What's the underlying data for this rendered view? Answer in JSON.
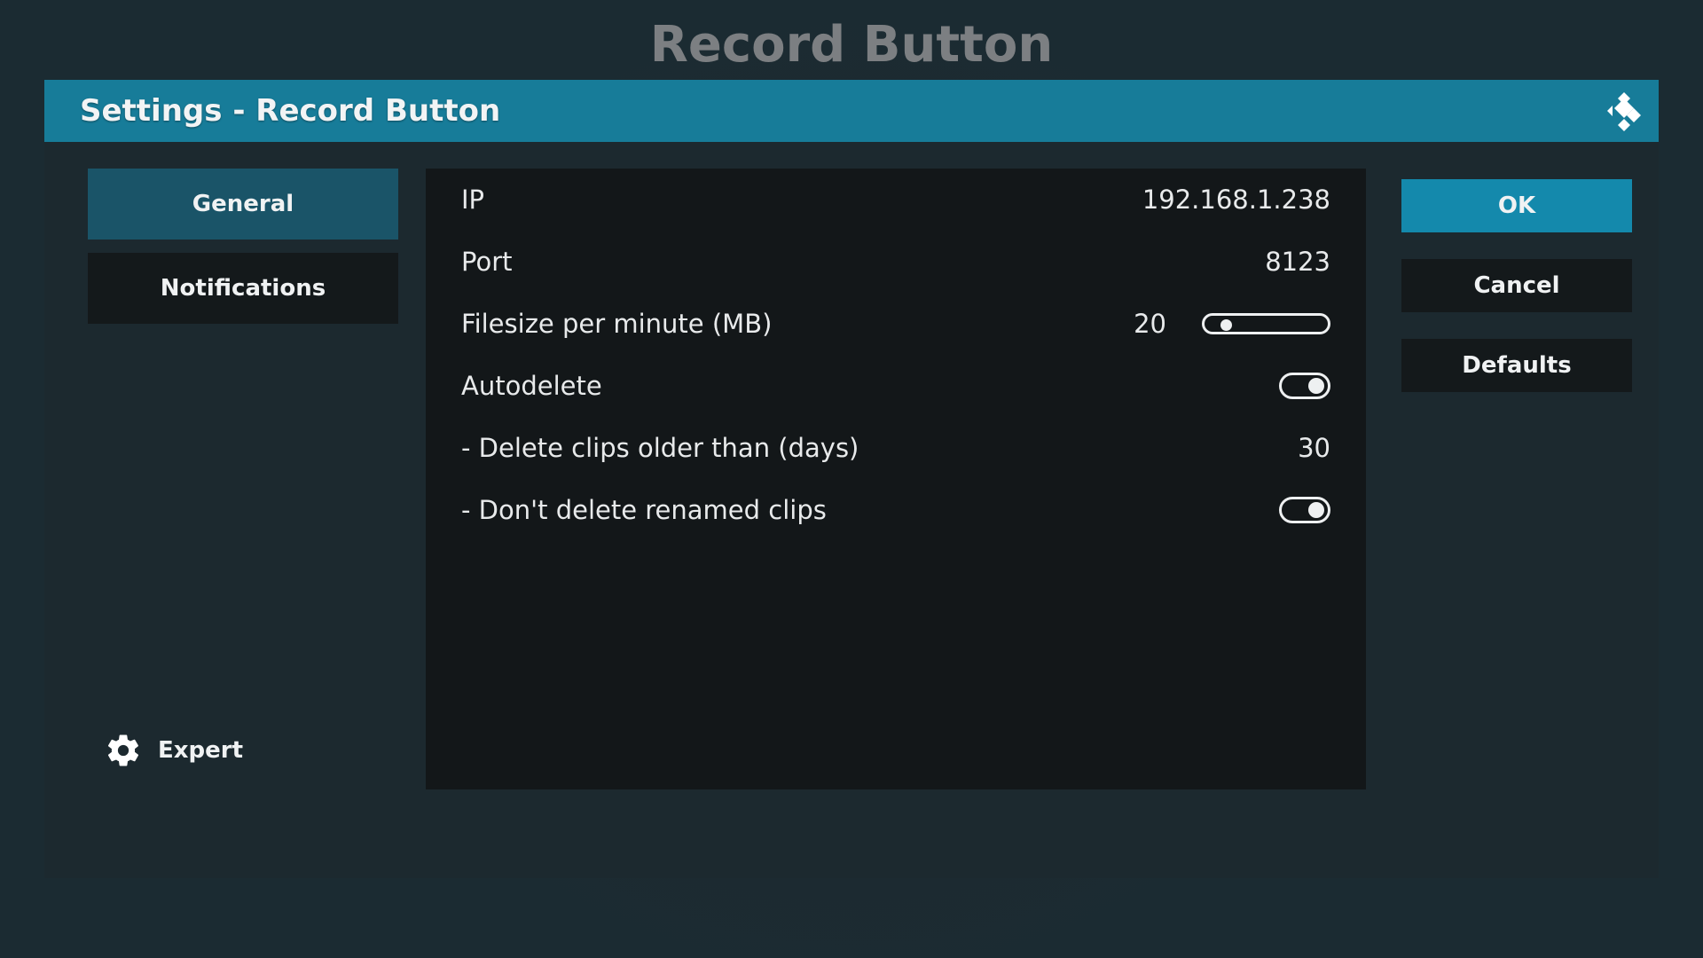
{
  "background_title": "Record Button",
  "dialog": {
    "title": "Settings - Record Button",
    "logo_icon": "kodi-logo-icon"
  },
  "categories": [
    {
      "label": "General",
      "active": true
    },
    {
      "label": "Notifications",
      "active": false
    }
  ],
  "settings": [
    {
      "label": "IP",
      "value": "192.168.1.238",
      "type": "text"
    },
    {
      "label": "Port",
      "value": "8123",
      "type": "text"
    },
    {
      "label": "Filesize per minute (MB)",
      "value": "20",
      "type": "slider"
    },
    {
      "label": "Autodelete",
      "type": "toggle",
      "checked": true
    },
    {
      "label": "- Delete clips older than (days)",
      "value": "30",
      "type": "text"
    },
    {
      "label": "- Don't delete renamed clips",
      "type": "toggle",
      "checked": true
    }
  ],
  "buttons": {
    "ok": "OK",
    "cancel": "Cancel",
    "defaults": "Defaults"
  },
  "level": {
    "label": "Expert",
    "icon": "gear-icon"
  },
  "colors": {
    "header": "#177c99",
    "active_tab": "#1a5468",
    "ok_button": "#1489ac"
  }
}
